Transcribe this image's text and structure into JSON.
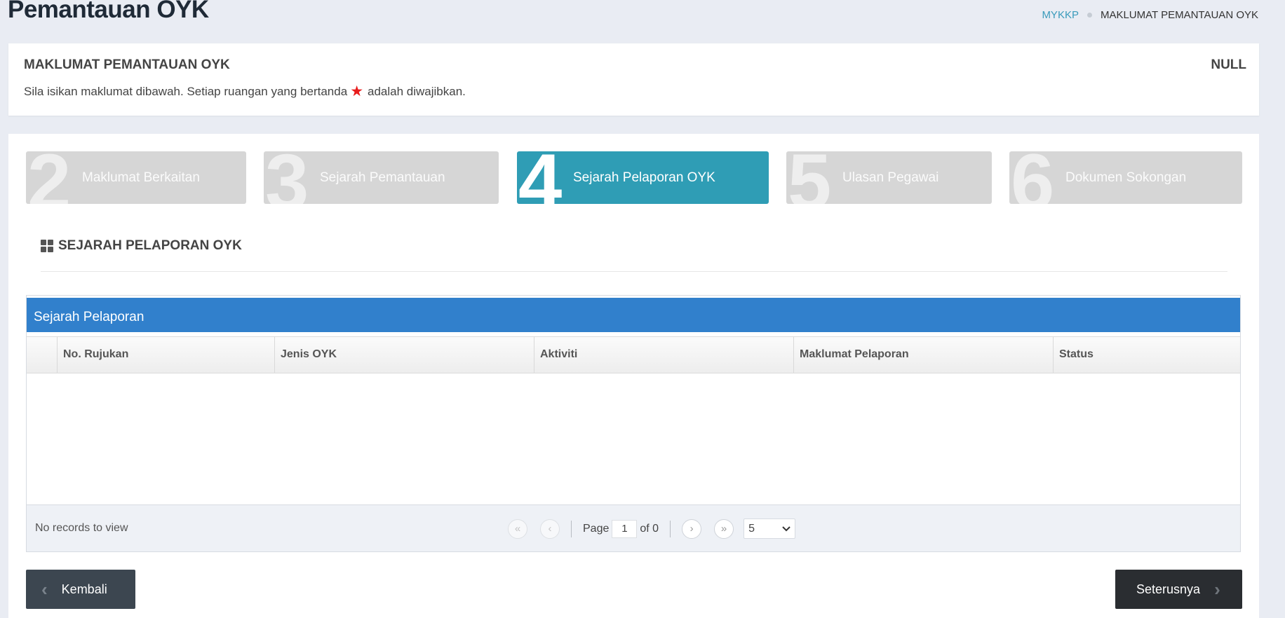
{
  "header": {
    "title": "Pemantauan OYK",
    "breadcrumb": [
      "MYKKP",
      "MAKLUMAT PEMANTAUAN OYK"
    ]
  },
  "info": {
    "title": "MAKLUMAT PEMANTAUAN OYK",
    "status": "NULL",
    "desc_before": "Sila isikan maklumat dibawah. Setiap ruangan yang bertanda",
    "desc_after": "adalah diwajibkan."
  },
  "steps": [
    {
      "num": "2",
      "label": "Maklumat Berkaitan",
      "active": false
    },
    {
      "num": "3",
      "label": "Sejarah Pemantauan",
      "active": false
    },
    {
      "num": "4",
      "label": "Sejarah Pelaporan OYK",
      "active": true
    },
    {
      "num": "5",
      "label": "Ulasan Pegawai",
      "active": false
    },
    {
      "num": "6",
      "label": "Dokumen Sokongan",
      "active": false
    }
  ],
  "section": {
    "title": "SEJARAH PELAPORAN OYK",
    "icon": "grid-icon"
  },
  "grid": {
    "caption": "Sejarah Pelaporan",
    "columns": [
      "",
      "No. Rujukan",
      "Jenis OYK",
      "Aktiviti",
      "Maklumat Pelaporan",
      "Status"
    ],
    "rows": [],
    "records_text": "No records to view",
    "pager": {
      "page_label": "Page",
      "page": "1",
      "of_label": "of 0",
      "page_size": "5"
    }
  },
  "buttons": {
    "back": "Kembali",
    "next": "Seterusnya"
  },
  "colors": {
    "accent": "#2f9db5",
    "caption": "#3180cc",
    "required": "#e81c1c"
  }
}
